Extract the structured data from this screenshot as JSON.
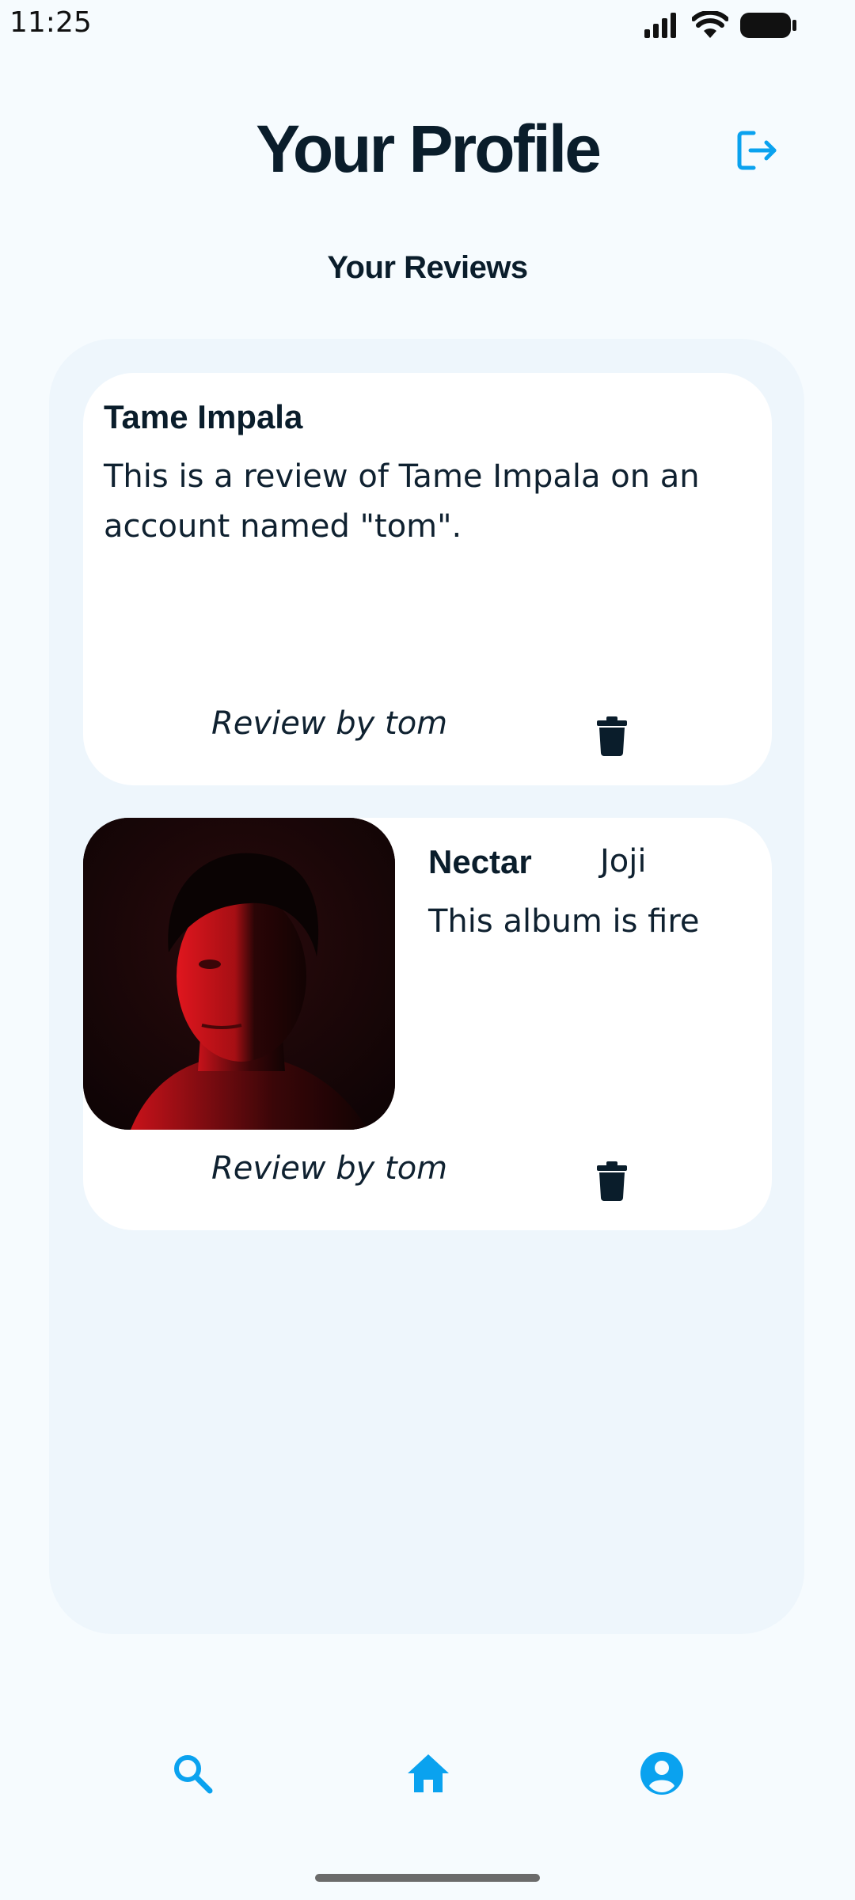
{
  "status_bar": {
    "time": "11:25"
  },
  "header": {
    "title": "Your Profile",
    "logout_icon": "logout-icon"
  },
  "section": {
    "title": "Your Reviews"
  },
  "reviews": [
    {
      "title": "Tame Impala",
      "body": "This is a review of Tame Impala on an account named \"tom\".",
      "byline": "Review by tom",
      "delete_icon": "trash-icon"
    },
    {
      "title": "Nectar",
      "artist": "Joji",
      "body": "This album is fire",
      "byline": "Review by tom",
      "delete_icon": "trash-icon",
      "has_album_art": true
    }
  ],
  "bottom_nav": [
    {
      "icon": "search-icon"
    },
    {
      "icon": "home-icon"
    },
    {
      "icon": "account-icon"
    }
  ],
  "colors": {
    "accent": "#0aa2ef",
    "text_dark": "#0a1d2b",
    "background": "#f6fbfe",
    "panel": "#eef6fc",
    "card": "#ffffff"
  }
}
